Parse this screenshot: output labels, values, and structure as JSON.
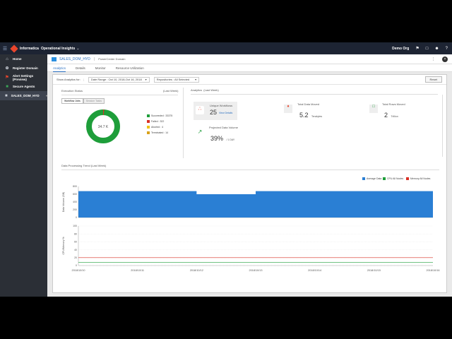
{
  "topbar": {
    "brand": "Informatica",
    "product": "Operational Insights",
    "org": "Demo Org"
  },
  "sidebar": {
    "items": [
      {
        "label": "Home"
      },
      {
        "label": "Register Domain"
      },
      {
        "label": "Alert Settings (Preview)"
      },
      {
        "label": "Secure Agents"
      },
      {
        "label": "SALES_DOM_HYD"
      }
    ]
  },
  "header": {
    "domain_name": "SALES_DOM_HYD",
    "domain_type": "PowerCenter Domain"
  },
  "tabs": [
    {
      "label": "Analytics"
    },
    {
      "label": "Details"
    },
    {
      "label": "Monitor"
    },
    {
      "label": "Resource Utilization"
    }
  ],
  "filter": {
    "label": "Show Analytics for:",
    "date_range": "Date Range : Oct 10, 2018-Oct 16, 2018",
    "repositories": "Repositories : All Selected",
    "reset": "Reset"
  },
  "execution_status": {
    "title": "Execution Status",
    "period": "(Last Week)",
    "btn_workflow": "Workflow Jobs",
    "btn_session": "Session Tasks",
    "center_value": "34.7 K",
    "legend": [
      {
        "label": "Succeeded : 33375",
        "color": "#1e9e3a"
      },
      {
        "label": "Failed : 322",
        "color": "#d93025"
      },
      {
        "label": "Aborted : 4",
        "color": "#f0c419"
      },
      {
        "label": "Terminated : 14",
        "color": "#d9a21b"
      }
    ],
    "donut": {
      "succeeded": 33375,
      "failed": 322,
      "aborted": 4,
      "terminated": 14
    }
  },
  "analytics": {
    "title": "Analytics",
    "period": "(Last Week)",
    "unique_workflows_label": "Unique Workflows",
    "unique_workflows_value": "25",
    "view_details": "View Details",
    "data_moved_label": "Total Data Moved",
    "data_moved_value": "5.2",
    "data_moved_unit": "Terabytes",
    "rows_moved_label": "Total Rows Moved",
    "rows_moved_value": "2",
    "rows_moved_unit": "Trillion",
    "projected_label": "Projected Data Volume",
    "projected_value": "39%",
    "projected_unit": "/ 1 DAY"
  },
  "trend": {
    "title": "Data Processing Trend (Last Week)",
    "legend": [
      {
        "label": "Average Data",
        "color": "#2a7fd4"
      },
      {
        "label": "CPU All Nodes",
        "color": "#1e9e3a"
      },
      {
        "label": "Memory All Nodes",
        "color": "#d93025"
      }
    ],
    "ylabel_top": "Data Volume (GB)",
    "ylabel_bottom": "CPU/Memory %",
    "x_labels": [
      "2018/10/10",
      "2018/10/11",
      "2018/10/12",
      "2018/10/13",
      "2018/10/14",
      "2018/10/15",
      "2018/10/16"
    ],
    "y_top_ticks": [
      "800",
      "600",
      "400",
      "200",
      "0"
    ],
    "y_bottom_ticks": [
      "100",
      "80",
      "60",
      "40",
      "20",
      "0"
    ]
  },
  "chart_data": {
    "type": "area",
    "title": "Data Processing Trend (Last Week)",
    "categories": [
      "2018/10/10",
      "2018/10/11",
      "2018/10/12",
      "2018/10/13",
      "2018/10/14",
      "2018/10/15",
      "2018/10/16"
    ],
    "series": [
      {
        "name": "Average Data",
        "values": [
          680,
          680,
          600,
          680,
          680,
          680,
          680
        ]
      },
      {
        "name": "CPU All Nodes",
        "values": [
          8,
          8,
          8,
          8,
          8,
          8,
          8
        ]
      },
      {
        "name": "Memory All Nodes",
        "values": [
          20,
          20,
          20,
          20,
          20,
          20,
          20
        ]
      }
    ],
    "ylim": [
      0,
      800
    ],
    "legend": "top-right"
  }
}
